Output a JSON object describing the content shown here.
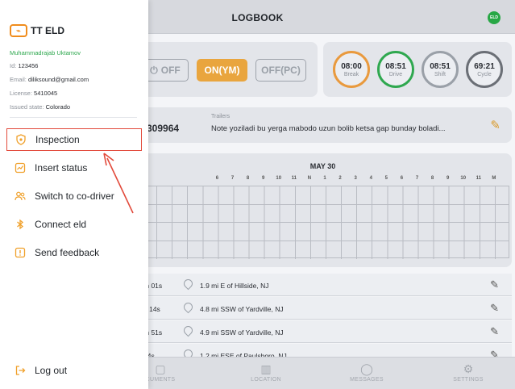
{
  "header": {
    "title": "LOGBOOK",
    "badge": "ELD"
  },
  "status": {
    "off": "OFF",
    "on": "ON(YM)",
    "offpc": "OFF(PC)"
  },
  "clocks": [
    {
      "value": "08:00",
      "label": "Break",
      "color": "#e99a3e"
    },
    {
      "value": "08:51",
      "label": "Drive",
      "color": "#2fa84f"
    },
    {
      "value": "08:51",
      "label": "Shift",
      "color": "#9aa0a8"
    },
    {
      "value": "69:21",
      "label": "Cycle",
      "color": "#6b6f76"
    }
  ],
  "trailer": {
    "number": "309964",
    "label": "Trailers",
    "note": "Note yoziladi bu yerga mabodo uzun bolib ketsa gap bunday boladi..."
  },
  "graph": {
    "date": "MAY 30",
    "hours": [
      "6",
      "7",
      "8",
      "9",
      "10",
      "11",
      "N",
      "1",
      "2",
      "3",
      "4",
      "5",
      "6",
      "7",
      "8",
      "9",
      "10",
      "11",
      "M"
    ]
  },
  "log_rows": [
    {
      "duration": "m 01s",
      "location": "1.9 mi E of Hillside, NJ"
    },
    {
      "duration": "n 14s",
      "location": "4.8 mi SSW of Yardville, NJ"
    },
    {
      "duration": "m 51s",
      "location": "4.9 mi SSW of Yardville, NJ"
    },
    {
      "duration": "14s",
      "location": "1.2 mi ESE of Paulsboro, NJ"
    }
  ],
  "bottom_nav": [
    {
      "label": "CUMENTS",
      "icon": "document-icon"
    },
    {
      "label": "LOCATION",
      "icon": "map-icon"
    },
    {
      "label": "MESSAGES",
      "icon": "chat-icon"
    },
    {
      "label": "SETTINGS",
      "icon": "gear-icon"
    }
  ],
  "drawer": {
    "brand": "TT ELD",
    "user_name": "Muhammadrajab Uktamov",
    "id_label": "Id:",
    "id_value": "123456",
    "email_label": "Email:",
    "email_value": "diliksound@gmail.com",
    "license_label": "License:",
    "license_value": "5410045",
    "state_label": "Issued state:",
    "state_value": "Colorado",
    "menu": [
      {
        "label": "Inspection",
        "icon": "shield-icon"
      },
      {
        "label": "Insert status",
        "icon": "chart-icon"
      },
      {
        "label": "Switch to co-driver",
        "icon": "users-icon"
      },
      {
        "label": "Connect eld",
        "icon": "bluetooth-icon"
      },
      {
        "label": "Send feedback",
        "icon": "feedback-icon"
      }
    ],
    "logout": "Log out",
    "accent": "#f0a02a",
    "highlight": "#e24a3b"
  }
}
